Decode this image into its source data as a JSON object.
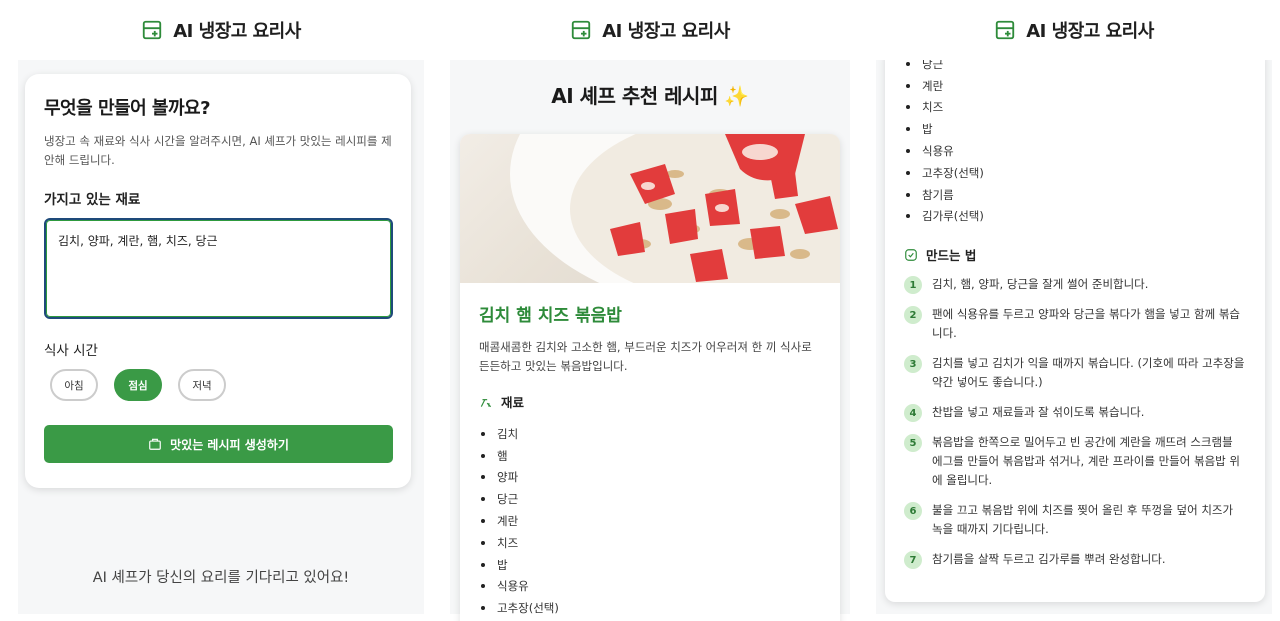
{
  "app": {
    "title": "AI 냉장고 요리사"
  },
  "input_screen": {
    "heading": "무엇을 만들어 볼까요?",
    "description": "냉장고 속 재료와 식사 시간을 알려주시면, AI 셰프가 맛있는 레시피를 제안해 드립니다.",
    "ingredients_label": "가지고 있는 재료",
    "ingredients_value": "김치, 양파, 계란, 햄, 치즈, 당근",
    "meal_label": "식사 시간",
    "meals": [
      "아침",
      "점심",
      "저녁"
    ],
    "selected_meal": "점심",
    "generate_label": "맛있는 레시피 생성하기",
    "waiting_text": "AI 셰프가 당신의 요리를 기다리고 있어요!"
  },
  "result_screen": {
    "heading": "AI 셰프 추천 레시피 ✨",
    "recipe_title": "김치 햄 치즈 볶음밥",
    "recipe_desc": "매콤새콤한 김치와 고소한 햄, 부드러운 치즈가 어우러져 한 끼 식사로 든든하고 맛있는 볶음밥입니다.",
    "ingredients_heading": "재료",
    "ingredients": [
      "김치",
      "햄",
      "양파",
      "당근",
      "계란",
      "치즈",
      "밥",
      "식용유",
      "고추장(선택)"
    ]
  },
  "scrolled_screen": {
    "ingredients": [
      "당근",
      "계란",
      "치즈",
      "밥",
      "식용유",
      "고추장(선택)",
      "참기름",
      "김가루(선택)"
    ],
    "steps_heading": "만드는 법",
    "steps": [
      {
        "n": "1",
        "text": "김치, 햄, 양파, 당근을 잘게 썰어 준비합니다."
      },
      {
        "n": "2",
        "text": "팬에 식용유를 두르고 양파와 당근을 볶다가 햄을 넣고 함께 볶습니다."
      },
      {
        "n": "3",
        "text": "김치를 넣고 김치가 익을 때까지 볶습니다. (기호에 따라 고추장을 약간 넣어도 좋습니다.)"
      },
      {
        "n": "4",
        "text": "찬밥을 넣고 재료들과 잘 섞이도록 볶습니다."
      },
      {
        "n": "5",
        "text": "볶음밥을 한쪽으로 밀어두고 빈 공간에 계란을 깨뜨려 스크램블 에그를 만들어 볶음밥과 섞거나, 계란 프라이를 만들어 볶음밥 위에 올립니다."
      },
      {
        "n": "6",
        "text": "불을 끄고 볶음밥 위에 치즈를 찢어 올린 후 뚜껑을 덮어 치즈가 녹을 때까지 기다립니다."
      },
      {
        "n": "7",
        "text": "참기름을 살짝 두르고 김가루를 뿌려 완성합니다."
      }
    ]
  },
  "colors": {
    "accent": "#3a9a46",
    "title_green": "#2e8b3a",
    "focus_border": "#1e4a7a"
  },
  "icons": {
    "logo": "fridge-plus-icon",
    "generate": "bag-icon",
    "ingredients": "ingredients-icon",
    "steps": "check-badge-icon"
  }
}
